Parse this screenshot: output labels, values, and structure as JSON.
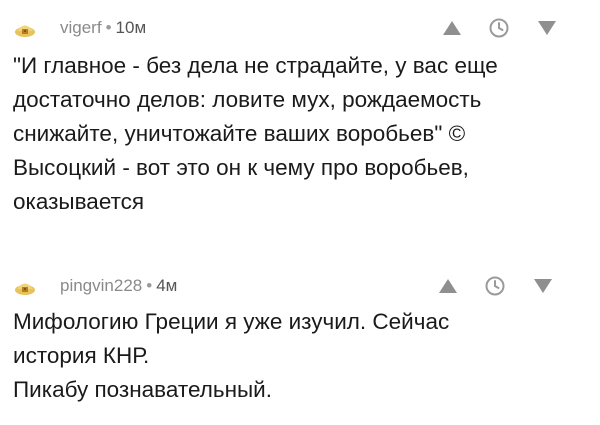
{
  "comments": [
    {
      "author": "vigerf",
      "separator": "•",
      "time": "10м",
      "avatar_icon": "default-avatar-icon",
      "text_lines": [
        "\"И главное - без дела не страдайте, у вас еще",
        "достаточно делов: ловите мух, рождаемость",
        "снижайте, уничтожайте ваших воробьев\" ©",
        "Высоцкий - вот это он к чему про воробьев,",
        "оказывается"
      ]
    },
    {
      "author": "pingvin228",
      "separator": "•",
      "time": "4м",
      "avatar_icon": "default-avatar-icon",
      "text_lines": [
        "Мифологию Греции я уже изучил. Сейчас",
        "история КНР.",
        "Пикабу познавательный."
      ]
    }
  ],
  "actions": {
    "upvote_icon": "triangle-up-icon",
    "save_icon": "clock-icon",
    "downvote_icon": "triangle-down-icon"
  },
  "colors": {
    "meta_text": "#8a8a8a",
    "time_text": "#555555",
    "body_text": "#1a1a1a",
    "icon": "#999999"
  }
}
